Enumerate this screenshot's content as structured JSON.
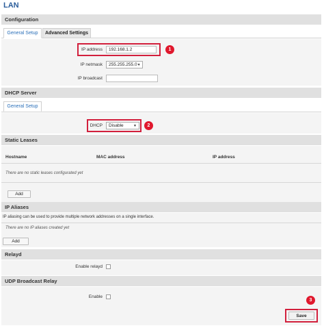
{
  "page": {
    "title": "LAN"
  },
  "configuration": {
    "header": "Configuration",
    "tabs": [
      {
        "label": "General Setup",
        "active": true
      },
      {
        "label": "Advanced Settings",
        "active": false
      }
    ],
    "fields": {
      "ip_address": {
        "label": "IP address",
        "value": "192.168.1.2"
      },
      "ip_netmask": {
        "label": "IP netmask",
        "value": "255.255.255.0"
      },
      "ip_broadcast": {
        "label": "IP broadcast",
        "value": ""
      }
    }
  },
  "dhcp_server": {
    "header": "DHCP Server",
    "tabs": [
      {
        "label": "General Setup",
        "active": true
      }
    ],
    "dhcp": {
      "label": "DHCP",
      "value": "Disable"
    }
  },
  "static_leases": {
    "header": "Static Leases",
    "columns": [
      "Hostname",
      "MAC address",
      "IP address"
    ],
    "empty_text": "There are no static leases configurated yet",
    "add_label": "Add"
  },
  "ip_aliases": {
    "header": "IP Aliases",
    "description": "IP aliasing can be used to provide multiple network addresses on a single interface.",
    "empty_text": "There are no IP aliases created yet",
    "add_label": "Add"
  },
  "relayd": {
    "header": "Relayd",
    "enable_label": "Enable relayd"
  },
  "udp_broadcast_relay": {
    "header": "UDP Broadcast Relay",
    "enable_label": "Enable"
  },
  "footer": {
    "save_label": "Save"
  },
  "markers": [
    "1",
    "2",
    "3"
  ],
  "colors": {
    "accent": "#2a6fb8",
    "highlight": "#d21f3c"
  }
}
